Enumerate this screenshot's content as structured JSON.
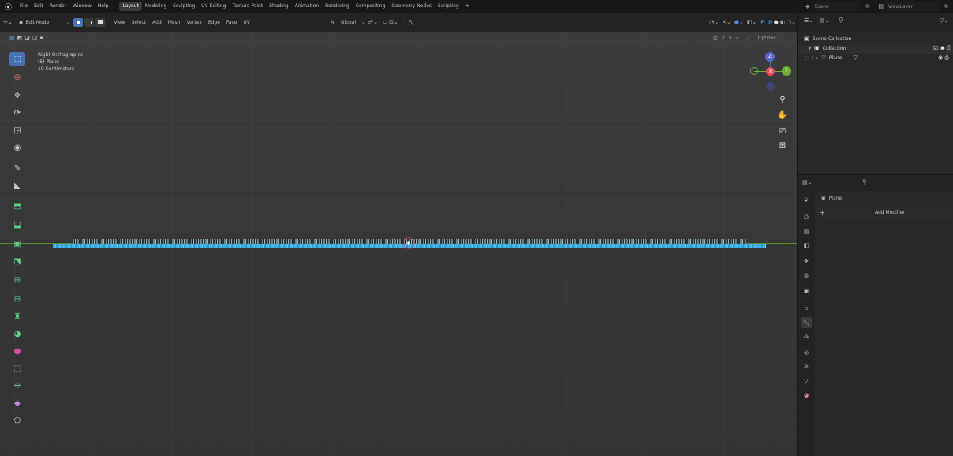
{
  "app": {
    "logo": "blender-logo-icon"
  },
  "menu": [
    "File",
    "Edit",
    "Render",
    "Window",
    "Help"
  ],
  "workspaces": {
    "tabs": [
      "Layout",
      "Modeling",
      "Sculpting",
      "UV Editing",
      "Texture Paint",
      "Shading",
      "Animation",
      "Rendering",
      "Compositing",
      "Geometry Nodes",
      "Scripting"
    ],
    "active": "Layout",
    "add": "+"
  },
  "scene": {
    "label": "Scene",
    "view_layer": "ViewLayer"
  },
  "header": {
    "mode": "Edit Mode",
    "menus": [
      "View",
      "Select",
      "Add",
      "Mesh",
      "Vertex",
      "Edge",
      "Face",
      "UV"
    ],
    "orientation": "Global",
    "options": "Options"
  },
  "axes_lock": {
    "x": "X",
    "y": "Y",
    "z": "Z"
  },
  "viewport": {
    "view_name": "Right Orthographic",
    "object_info": "(5) Plane",
    "scale": "10 Centimeters"
  },
  "gizmo": {
    "z": "Z",
    "y": "Y",
    "x": "X"
  },
  "outliner": {
    "root": "Scene Collection",
    "collection": "Collection",
    "object": "Plane"
  },
  "properties": {
    "object": "Plane",
    "add_modifier": "Add Modifier",
    "plus": "+"
  },
  "colors": {
    "accent": "#4772b3",
    "selected_mesh": "#3fb3e8",
    "x_axis": "#e54d5b",
    "y_axis": "#6ab030",
    "z_axis": "#5566cc"
  }
}
